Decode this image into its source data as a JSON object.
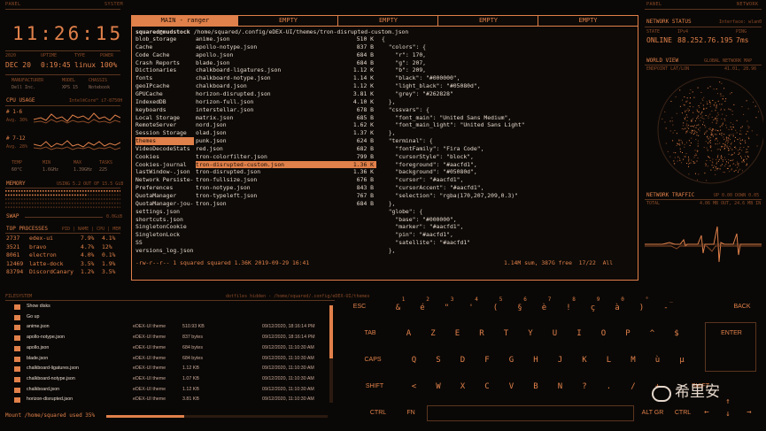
{
  "left": {
    "panel_label": "PANEL",
    "system_label": "SYSTEM",
    "clock": "11:26:15",
    "date": {
      "year_label": "2020",
      "date": "DEC 20",
      "uptime_label": "UPTIME",
      "uptime": "0:19:45",
      "type_label": "TYPE",
      "type": "linux",
      "power_label": "POWER",
      "power": "100%"
    },
    "hardware": {
      "manufacturer_label": "MANUFACTURER",
      "manufacturer": "Dell Inc.",
      "model_label": "MODEL",
      "model": "XPS 15",
      "chassis_label": "CHASSIS",
      "chassis": "Notebook"
    },
    "cpu": {
      "title": "CPU USAGE",
      "model": "Intel®Core™ i7-8750H",
      "core1_label": "# 1-6",
      "core1_avg": "Avg. 30%",
      "core2_label": "# 7-12",
      "core2_avg": "Avg. 28%"
    },
    "stats": {
      "temp_label": "TEMP",
      "temp": "60°C",
      "min_label": "MIN",
      "min": "1.6GHz",
      "max_label": "MAX",
      "max": "1.39GHz",
      "tasks_label": "TASKS",
      "tasks": "225"
    },
    "memory": {
      "title": "MEMORY",
      "detail": "USING 5.2 OUT OF 15.5 GiB",
      "swap_label": "SWAP",
      "swap_value": "0.0GiB"
    },
    "processes": {
      "title": "TOP PROCESSES",
      "cols": "PID | NAME | CPU | MEM",
      "rows": [
        {
          "pid": "2737",
          "name": "edex-ui",
          "cpu": "7.9%",
          "mem": "4.1%"
        },
        {
          "pid": "3521",
          "name": "bravo",
          "cpu": "4.7%",
          "mem": "12%"
        },
        {
          "pid": "8061",
          "name": "electron",
          "cpu": "4.0%",
          "mem": "0.1%"
        },
        {
          "pid": "12469",
          "name": "latte-dock",
          "cpu": "3.5%",
          "mem": "1.9%"
        },
        {
          "pid": "83794",
          "name": "DiscordCanary",
          "cpu": "1.2%",
          "mem": "3.5%"
        }
      ]
    }
  },
  "terminal": {
    "tabs": [
      "MAIN - ranger",
      "EMPTY",
      "EMPTY",
      "EMPTY",
      "EMPTY"
    ],
    "path_user": "squared@mudstock",
    "path": " /home/squared/.config/eDEX-UI/themes/tron-disrupted-custom.json",
    "dirs": [
      "blob_storage",
      "Cache",
      "Code Cache",
      "Crash Reports",
      "Dictionaries",
      "fonts",
      "geoIPcache",
      "GPUCache",
      "IndexedDB",
      "keyboards",
      "Local Storage",
      "RemoteServer",
      "Session Storage",
      "themes",
      "VideoDecodeStats",
      "Cookies",
      "Cookies-journal",
      "lastWindow-.json",
      "Network Persiste-",
      "Preferences",
      "QuotaManager",
      "QuotaManager-jou-",
      "settings.json",
      "shortcuts.json",
      "SingletonCookie",
      "SingletonLock",
      "SS",
      "versions_log.json"
    ],
    "files": [
      {
        "name": "anime.json",
        "size": "510 K"
      },
      {
        "name": "apollo-notype.json",
        "size": "837 B"
      },
      {
        "name": "apollo.json",
        "size": "684 B"
      },
      {
        "name": "blade.json",
        "size": "684 B"
      },
      {
        "name": "chalkboard-ligatures.json",
        "size": "1.12 K"
      },
      {
        "name": "chalkboard-notype.json",
        "size": "1.14 K"
      },
      {
        "name": "chalkboard.json",
        "size": "1.12 K"
      },
      {
        "name": "horizon-disrupted.json",
        "size": "3.81 K"
      },
      {
        "name": "horizon-full.json",
        "size": "4.10 K"
      },
      {
        "name": "interstellar.json",
        "size": "678 B"
      },
      {
        "name": "matrix.json",
        "size": "685 B"
      },
      {
        "name": "nord.json",
        "size": "1.62 K"
      },
      {
        "name": "olad.json",
        "size": "1.37 K"
      },
      {
        "name": "punk.json",
        "size": "624 B"
      },
      {
        "name": "red.json",
        "size": "682 B"
      },
      {
        "name": "tron-colorfilter.json",
        "size": "799 B"
      },
      {
        "name": "tron-disrupted-custom.json",
        "size": "1.36 K"
      },
      {
        "name": "tron-disrupted.json",
        "size": "1.36 K"
      },
      {
        "name": "tron-fullsize.json",
        "size": "676 B"
      },
      {
        "name": "tron-notype.json",
        "size": "843 B"
      },
      {
        "name": "tron-typeleft.json",
        "size": "767 B"
      },
      {
        "name": "tron.json",
        "size": "684 B"
      }
    ],
    "json_lines": [
      "{",
      "  \"colors\": {",
      "    \"r\": 170,",
      "    \"g\": 207,",
      "    \"b\": 209,",
      "    \"black\": \"#000000\",",
      "    \"light_black\": \"#05080d\",",
      "    \"grey\": \"#262828\"",
      "  },",
      "  \"cssvars\": {",
      "    \"font_main\": \"United Sans Medium\",",
      "    \"font_main_light\": \"United Sans Light\"",
      "  },",
      "  \"terminal\": {",
      "    \"fontFamily\": \"Fira Code\",",
      "    \"cursorStyle\": \"block\",",
      "    \"foreground\": \"#aacfd1\",",
      "    \"background\": \"#05080d\",",
      "    \"cursor\": \"#aacfd1\",",
      "    \"cursorAccent\": \"#aacfd1\",",
      "    \"selection\": \"rgba(170,207,209,0.3)\"",
      "  },",
      "  \"globe\": {",
      "    \"base\": \"#000000\",",
      "    \"marker\": \"#aacfd1\",",
      "    \"pin\": \"#aacfd1\",",
      "    \"satellite\": \"#aacfd1\"",
      "  },"
    ],
    "status_left": "-rw-r--r-- 1 squared squared 1.36K 2019-09-29 16:41",
    "status_right": "1.14M sum, 387G free  17/22  All"
  },
  "right": {
    "panel_label": "PANEL",
    "network_label": "NETWORK",
    "net_status_title": "NETWORK STATUS",
    "net_iface": "Interface: wlan0",
    "state_label": "STATE",
    "state": "ONLINE",
    "ipv4_label": "IPv4",
    "ipv4": "88.252.76.195",
    "ping_label": "PING",
    "ping": "7ms",
    "world_title": "WORLD VIEW",
    "world_sub": "GLOBAL NETWORK MAP",
    "endpoint_label": "ENDPOINT LAT/LON",
    "endpoint_val": "41.01, 28.96",
    "traffic_title": "NETWORK TRAFFIC",
    "traffic_val": "UP 0.00 DOWN 0.05",
    "total_label": "TOTAL",
    "total_val": "4.06 MB OUT, 24.6 MB IN"
  },
  "files": {
    "label": "FILESYSTEM",
    "path": "dotfiles hidden - /home/squared/.config/eDEX-UI/themes",
    "rows": [
      {
        "name": "Show disks",
        "type": "",
        "size": "",
        "date": ""
      },
      {
        "name": "Go up",
        "type": "",
        "size": "",
        "date": ""
      },
      {
        "name": "anime.json",
        "type": "eDEX-UI theme",
        "size": "510.93 KB",
        "date": "09/12/2020, 18:16:14 PM"
      },
      {
        "name": "apollo-notype.json",
        "type": "eDEX-UI theme",
        "size": "837 bytes",
        "date": "09/12/2020, 18:16:14 PM"
      },
      {
        "name": "apollo.json",
        "type": "eDEX-UI theme",
        "size": "684 bytes",
        "date": "09/12/2020, 11:10:30 AM"
      },
      {
        "name": "blade.json",
        "type": "eDEX-UI theme",
        "size": "684 bytes",
        "date": "09/12/2020, 11:10:30 AM"
      },
      {
        "name": "chalkboard-ligatures.json",
        "type": "eDEX-UI theme",
        "size": "1.12 KB",
        "date": "09/12/2020, 11:10:30 AM"
      },
      {
        "name": "chalkboard-notype.json",
        "type": "eDEX-UI theme",
        "size": "1.07 KB",
        "date": "09/12/2020, 11:10:30 AM"
      },
      {
        "name": "chalkboard.json",
        "type": "eDEX-UI theme",
        "size": "1.12 KB",
        "date": "09/12/2020, 11:10:30 AM"
      },
      {
        "name": "horizon-disrupted.json",
        "type": "eDEX-UI theme",
        "size": "3.81 KB",
        "date": "09/12/2020, 11:10:30 AM"
      }
    ],
    "mount": "Mount /home/squared used 35%"
  },
  "keyboard": {
    "row1": [
      "ESC",
      "&",
      "é",
      "\"",
      "'",
      "(",
      "§",
      "è",
      "!",
      "ç",
      "à",
      ")",
      "-",
      "BACK"
    ],
    "row1_top": [
      "1",
      "2",
      "3",
      "4",
      "5",
      "6",
      "7",
      "8",
      "9",
      "0",
      "°",
      "_"
    ],
    "row2": [
      "TAB",
      "A",
      "Z",
      "E",
      "R",
      "T",
      "Y",
      "U",
      "I",
      "O",
      "P",
      "^",
      "$",
      "ENTER"
    ],
    "row3": [
      "CAPS",
      "Q",
      "S",
      "D",
      "F",
      "G",
      "H",
      "J",
      "K",
      "L",
      "M",
      "ù",
      "µ"
    ],
    "row4": [
      "SHIFT",
      "<",
      "W",
      "X",
      "C",
      "V",
      "B",
      "N",
      "?",
      ".",
      "/",
      "+",
      "SHIFT"
    ],
    "row5": [
      "CTRL",
      "FN",
      "ALT GR",
      "CTRL"
    ],
    "arrows": [
      "←",
      "↑",
      "↓",
      "→"
    ]
  },
  "watermark": "希里安"
}
